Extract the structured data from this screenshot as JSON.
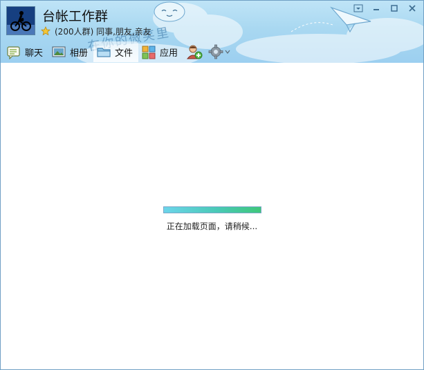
{
  "window": {
    "group_name": "台帐工作群",
    "group_info": "(200人群) 同事,朋友,亲友",
    "decor_text": "在你的微笑里"
  },
  "tabs": [
    {
      "label": "聊天",
      "icon": "chat-icon"
    },
    {
      "label": "相册",
      "icon": "album-icon"
    },
    {
      "label": "文件",
      "icon": "folder-icon"
    },
    {
      "label": "应用",
      "icon": "apps-icon"
    }
  ],
  "active_tab": "文件",
  "loading": {
    "text": "正在加载页面，请稍候...",
    "progress": 1.0
  },
  "colors": {
    "header_bg": "#a9d8f1",
    "progress_start": "#6cd5ea",
    "progress_end": "#3fc77a"
  }
}
